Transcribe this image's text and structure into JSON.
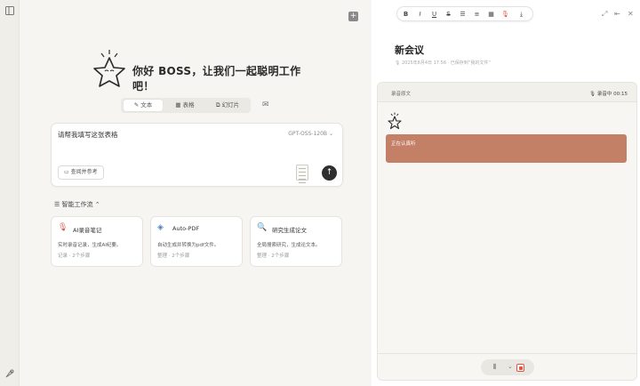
{
  "main": {
    "greeting": "你好 BOSS，让我们一起聪明工作吧！",
    "modes": [
      {
        "label": "文本",
        "icon": "pencil-icon",
        "active": true
      },
      {
        "label": "表格",
        "icon": "table-icon",
        "active": false
      },
      {
        "label": "幻灯片",
        "icon": "slides-icon",
        "active": false
      }
    ],
    "composer": {
      "query": "请帮我填写这张表格",
      "model": "GPT-OSS-120B ⌄",
      "reference_button": "查阅并参考"
    },
    "workflows": {
      "title": "智能工作流 ⌃",
      "cards": [
        {
          "name": "AI录音笔记",
          "desc": "实时录音记录，生成AI纪要。",
          "meta": "记录 · 2个步骤",
          "icon": "microphone-icon"
        },
        {
          "name": "Auto-PDF",
          "desc": "自动生成并转换为pdf文件。",
          "meta": "整理 · 2个步骤",
          "icon": "layers-icon"
        },
        {
          "name": "研究生成论文",
          "desc": "全局搜索研究，生成论文本。",
          "meta": "整理 · 2个步骤",
          "icon": "document-search-icon"
        }
      ]
    }
  },
  "right_panel": {
    "meeting_title": "新会议",
    "meeting_subtitle": "2025年8月4日 17:56 · 已保存到“我的文件”",
    "transcript_header": "录音原文",
    "timer": "00:15",
    "listening_text": "正在认真听"
  },
  "colors": {
    "accent_listen": "#c47f67",
    "send_button": "#2f2f2f",
    "record_red": "#e0553f"
  }
}
